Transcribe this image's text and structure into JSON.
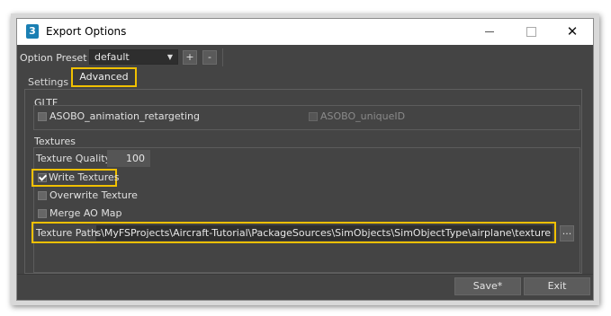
{
  "window": {
    "title": "Export Options",
    "app_icon_label": "3",
    "close_glyph": "✕"
  },
  "preset": {
    "label": "Option Preset :",
    "value": "default",
    "arrow": "▼",
    "plus": "+",
    "minus": "-"
  },
  "tabs": [
    {
      "label": "Settings",
      "active": false
    },
    {
      "label": "Advanced",
      "active": true
    }
  ],
  "gltf": {
    "title": "GLTF",
    "animation_retargeting": {
      "label": "ASOBO_animation_retargeting",
      "checked": false
    },
    "unique_id": {
      "label": "ASOBO_uniqueID",
      "checked": false,
      "enabled": false
    }
  },
  "textures": {
    "title": "Textures",
    "quality_label": "Texture Quality",
    "quality_value": "100",
    "write_textures": {
      "label": "Write Textures",
      "checked": true
    },
    "overwrite_texture": {
      "label": "Overwrite Texture",
      "checked": false
    },
    "merge_ao_map": {
      "label": "Merge AO Map",
      "checked": false
    },
    "path_label": "Texture Path",
    "path_value": "Documents\\MyFSProjects\\Aircraft-Tutorial\\PackageSources\\SimObjects\\SimObjectType\\airplane\\texture",
    "browse_label": "..."
  },
  "buttons": {
    "save": "Save*",
    "exit": "Exit"
  },
  "colors": {
    "highlight": "#f0c000",
    "panel_bg": "#444444",
    "field_bg": "#2e2e2e"
  }
}
